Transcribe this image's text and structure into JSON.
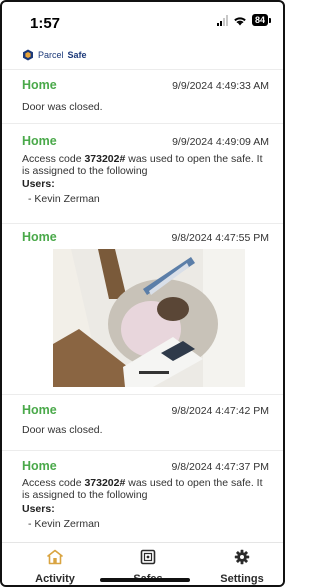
{
  "status_bar": {
    "time": "1:57",
    "battery": "84"
  },
  "header": {
    "logo_word1": "Parcel",
    "logo_word2": "Safe"
  },
  "entries": [
    {
      "location": "Home",
      "timestamp": "9/9/2024 4:49:33 AM",
      "text": "Door was closed."
    },
    {
      "location": "Home",
      "timestamp": "9/9/2024 4:49:09 AM",
      "text_before": "Access code ",
      "code": "373202#",
      "text_after": " was used to open the safe. It is assigned to the following",
      "users_label": "Users:",
      "user": "- Kevin Zerman"
    },
    {
      "location": "Home",
      "timestamp": "9/8/2024 4:47:55 PM"
    },
    {
      "location": "Home",
      "timestamp": "9/8/2024 4:47:42 PM",
      "text": "Door was closed."
    },
    {
      "location": "Home",
      "timestamp": "9/8/2024 4:47:37 PM",
      "text_before": "Access code ",
      "code": "373202#",
      "text_after": " was used to open the safe. It is assigned to the following",
      "users_label": "Users:",
      "user": "- Kevin Zerman"
    }
  ],
  "tabs": [
    {
      "label": "Activity",
      "icon": "home-icon",
      "active": true
    },
    {
      "label": "Safes",
      "icon": "safe-icon"
    },
    {
      "label": "Settings",
      "icon": "gear-icon"
    }
  ],
  "colors": {
    "accent_green": "#4aa94a",
    "tab_active": "#d9a441"
  }
}
